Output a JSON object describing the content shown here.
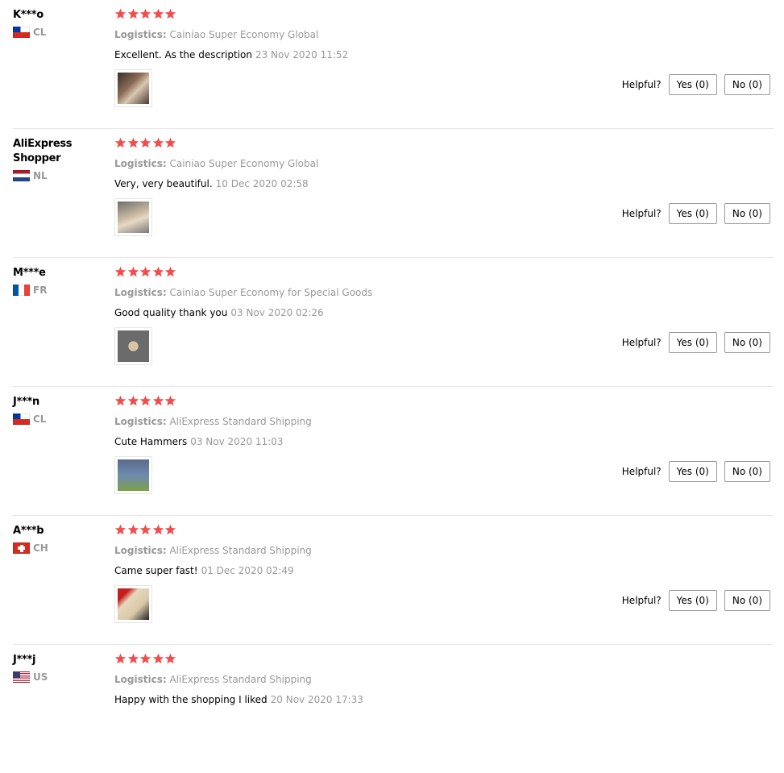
{
  "helpful_label": "Helpful?",
  "logistics_label": "Logistics:",
  "star_color": "#f44b4b",
  "reviews": [
    {
      "user": "K***o",
      "country": "CL",
      "flag": "chile",
      "rating": 5,
      "logistics": "Cainiao Super Economy Global",
      "text": "Excellent. As the description",
      "date": "23 Nov 2020 11:52",
      "yes": "Yes (0)",
      "no": "No (0)",
      "photo": "product-photo"
    },
    {
      "user": "AliExpress Shopper",
      "country": "NL",
      "flag": "netherlands",
      "rating": 5,
      "logistics": "Cainiao Super Economy Global",
      "text": "Very, very beautiful.",
      "date": "10 Dec 2020 02:58",
      "yes": "Yes (0)",
      "no": "No (0)",
      "photo": "product-photo"
    },
    {
      "user": "M***e",
      "country": "FR",
      "flag": "france",
      "rating": 5,
      "logistics": "Cainiao Super Economy for Special Goods",
      "text": "Good quality thank you",
      "date": "03 Nov 2020 02:26",
      "yes": "Yes (0)",
      "no": "No (0)",
      "photo": "product-photo"
    },
    {
      "user": "J***n",
      "country": "CL",
      "flag": "chile",
      "rating": 5,
      "logistics": "AliExpress Standard Shipping",
      "text": "Cute Hammers",
      "date": "03 Nov 2020 11:03",
      "yes": "Yes (0)",
      "no": "No (0)",
      "photo": "product-photo"
    },
    {
      "user": "A***b",
      "country": "CH",
      "flag": "switzerland",
      "rating": 5,
      "logistics": "AliExpress Standard Shipping",
      "text": "Came super fast!",
      "date": "01 Dec 2020 02:49",
      "yes": "Yes (0)",
      "no": "No (0)",
      "photo": "product-photo"
    },
    {
      "user": "J***j",
      "country": "US",
      "flag": "usa",
      "rating": 5,
      "logistics": "AliExpress Standard Shipping",
      "text": "Happy with the shopping I liked",
      "date": "20 Nov 2020 17:33"
    }
  ]
}
